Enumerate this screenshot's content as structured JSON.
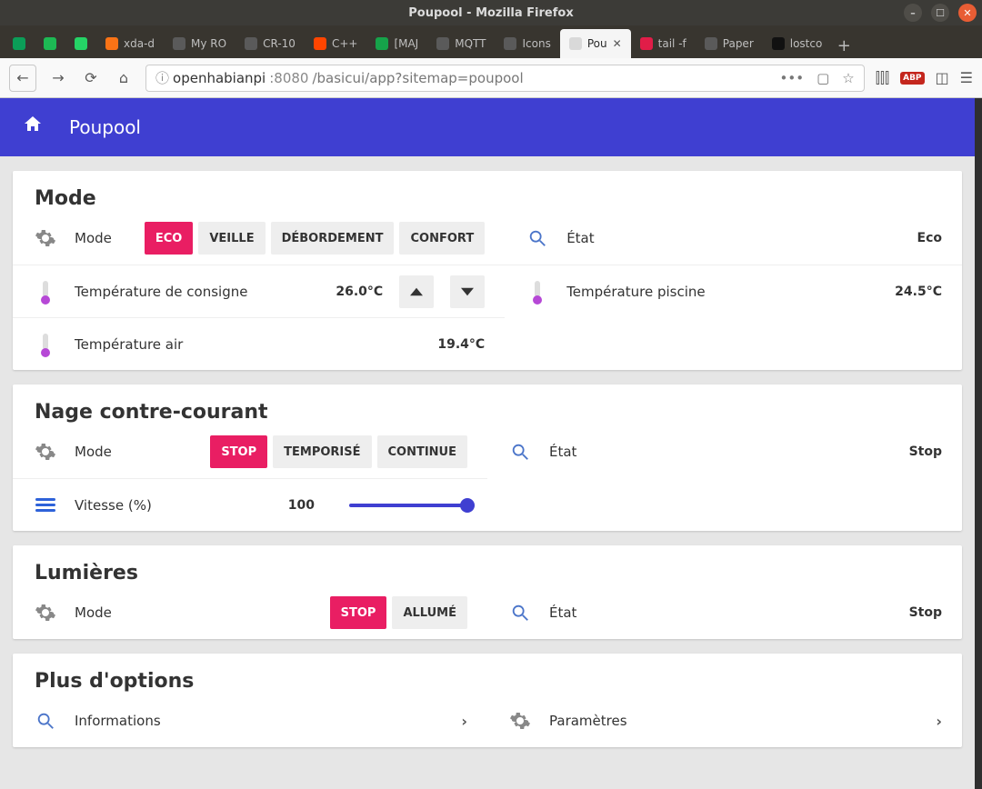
{
  "window": {
    "title": "Poupool - Mozilla Firefox"
  },
  "tabs": [
    {
      "label": "",
      "fav": "#0b9d58"
    },
    {
      "label": "",
      "fav": "#1db954"
    },
    {
      "label": "",
      "fav": "#25d366"
    },
    {
      "label": "xda-d",
      "fav": "#f97316"
    },
    {
      "label": "My RO",
      "fav": "#5a5a5a"
    },
    {
      "label": "CR-10",
      "fav": "#5a5a5a"
    },
    {
      "label": "C++",
      "fav": "#ff4500"
    },
    {
      "label": "[MAJ",
      "fav": "#16a34a"
    },
    {
      "label": "MQTT",
      "fav": "#5a5a5a"
    },
    {
      "label": "Icons",
      "fav": "#5a5a5a"
    },
    {
      "label": "Pou",
      "fav": "#d9d9d9",
      "active": true
    },
    {
      "label": "tail -f",
      "fav": "#e11d48"
    },
    {
      "label": "Paper",
      "fav": "#5a5a5a"
    },
    {
      "label": "lostco",
      "fav": "#111"
    }
  ],
  "url": {
    "host": "openhabianpi",
    "port": ":8080",
    "path": "/basicui/app?sitemap=poupool"
  },
  "app": {
    "title": "Poupool"
  },
  "mode": {
    "title": "Mode",
    "mode_label": "Mode",
    "eco": "ECO",
    "veille": "VEILLE",
    "debord": "DÉBORDEMENT",
    "confort": "CONFORT",
    "etat_label": "État",
    "etat_value": "Eco",
    "consigne_label": "Température de consigne",
    "consigne_value": "26.0°C",
    "piscine_label": "Température piscine",
    "piscine_value": "24.5°C",
    "air_label": "Température air",
    "air_value": "19.4°C"
  },
  "nage": {
    "title": "Nage contre-courant",
    "mode_label": "Mode",
    "stop": "STOP",
    "temp": "TEMPORISÉ",
    "cont": "CONTINUE",
    "etat_label": "État",
    "etat_value": "Stop",
    "vitesse_label": "Vitesse (%)",
    "vitesse_value": "100"
  },
  "lum": {
    "title": "Lumières",
    "mode_label": "Mode",
    "stop": "STOP",
    "on": "ALLUMÉ",
    "etat_label": "État",
    "etat_value": "Stop"
  },
  "plus": {
    "title": "Plus d'options",
    "info": "Informations",
    "param": "Paramètres"
  },
  "glyph": {
    "info": "ⓘ",
    "dots": "•••",
    "star": "☆",
    "book": "🕮",
    "reader": "▭",
    "menu": "☰",
    "back": "←",
    "fwd": "→",
    "reload": "⟳",
    "home": "⌂"
  }
}
